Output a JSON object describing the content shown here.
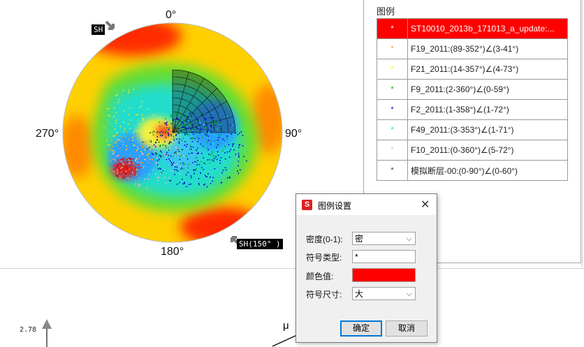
{
  "stereonet": {
    "north": "0°",
    "east": "90°",
    "south": "180°",
    "west": "270°",
    "sh_top_label": "SH",
    "sh_bottom_label": "SH(150° )"
  },
  "lower_plot": {
    "y_value_label": "2.78",
    "mu_label": "μ"
  },
  "legend": {
    "title": "图例",
    "items": [
      {
        "symbol": "*",
        "color": "#ffffff",
        "name": "ST10010_2013b_171013_a_update:..."
      },
      {
        "symbol": "*",
        "color": "#ff9900",
        "name": "F19_2011:(89-352°)∠(3-41°)"
      },
      {
        "symbol": "*",
        "color": "#ffee00",
        "name": "F21_2011:(14-357°)∠(4-73°)"
      },
      {
        "symbol": "*",
        "color": "#00aa00",
        "name": "F9_2011:(2-360°)∠(0-59°)"
      },
      {
        "symbol": "*",
        "color": "#0000cc",
        "name": "F2_2011:(1-358°)∠(1-72°)"
      },
      {
        "symbol": "*",
        "color": "#00ddee",
        "name": "F49_2011:(3-353°)∠(1-71°)"
      },
      {
        "symbol": "*",
        "color": "#ffb6c1",
        "name": "F10_2011:(0-360°)∠(5-72°)"
      },
      {
        "symbol": "*",
        "color": "#333333",
        "name": "模拟断层-00:(0-90°)∠(0-60°)"
      }
    ]
  },
  "dialog": {
    "title": "图例设置",
    "density_label": "密度(0-1):",
    "density_value": "密",
    "symbol_type_label": "符号类型:",
    "symbol_type_value": "*",
    "color_label": "颜色值:",
    "color_value": "#ff0000",
    "symbol_size_label": "符号尺寸:",
    "symbol_size_value": "大",
    "ok_label": "确定",
    "cancel_label": "取消"
  }
}
